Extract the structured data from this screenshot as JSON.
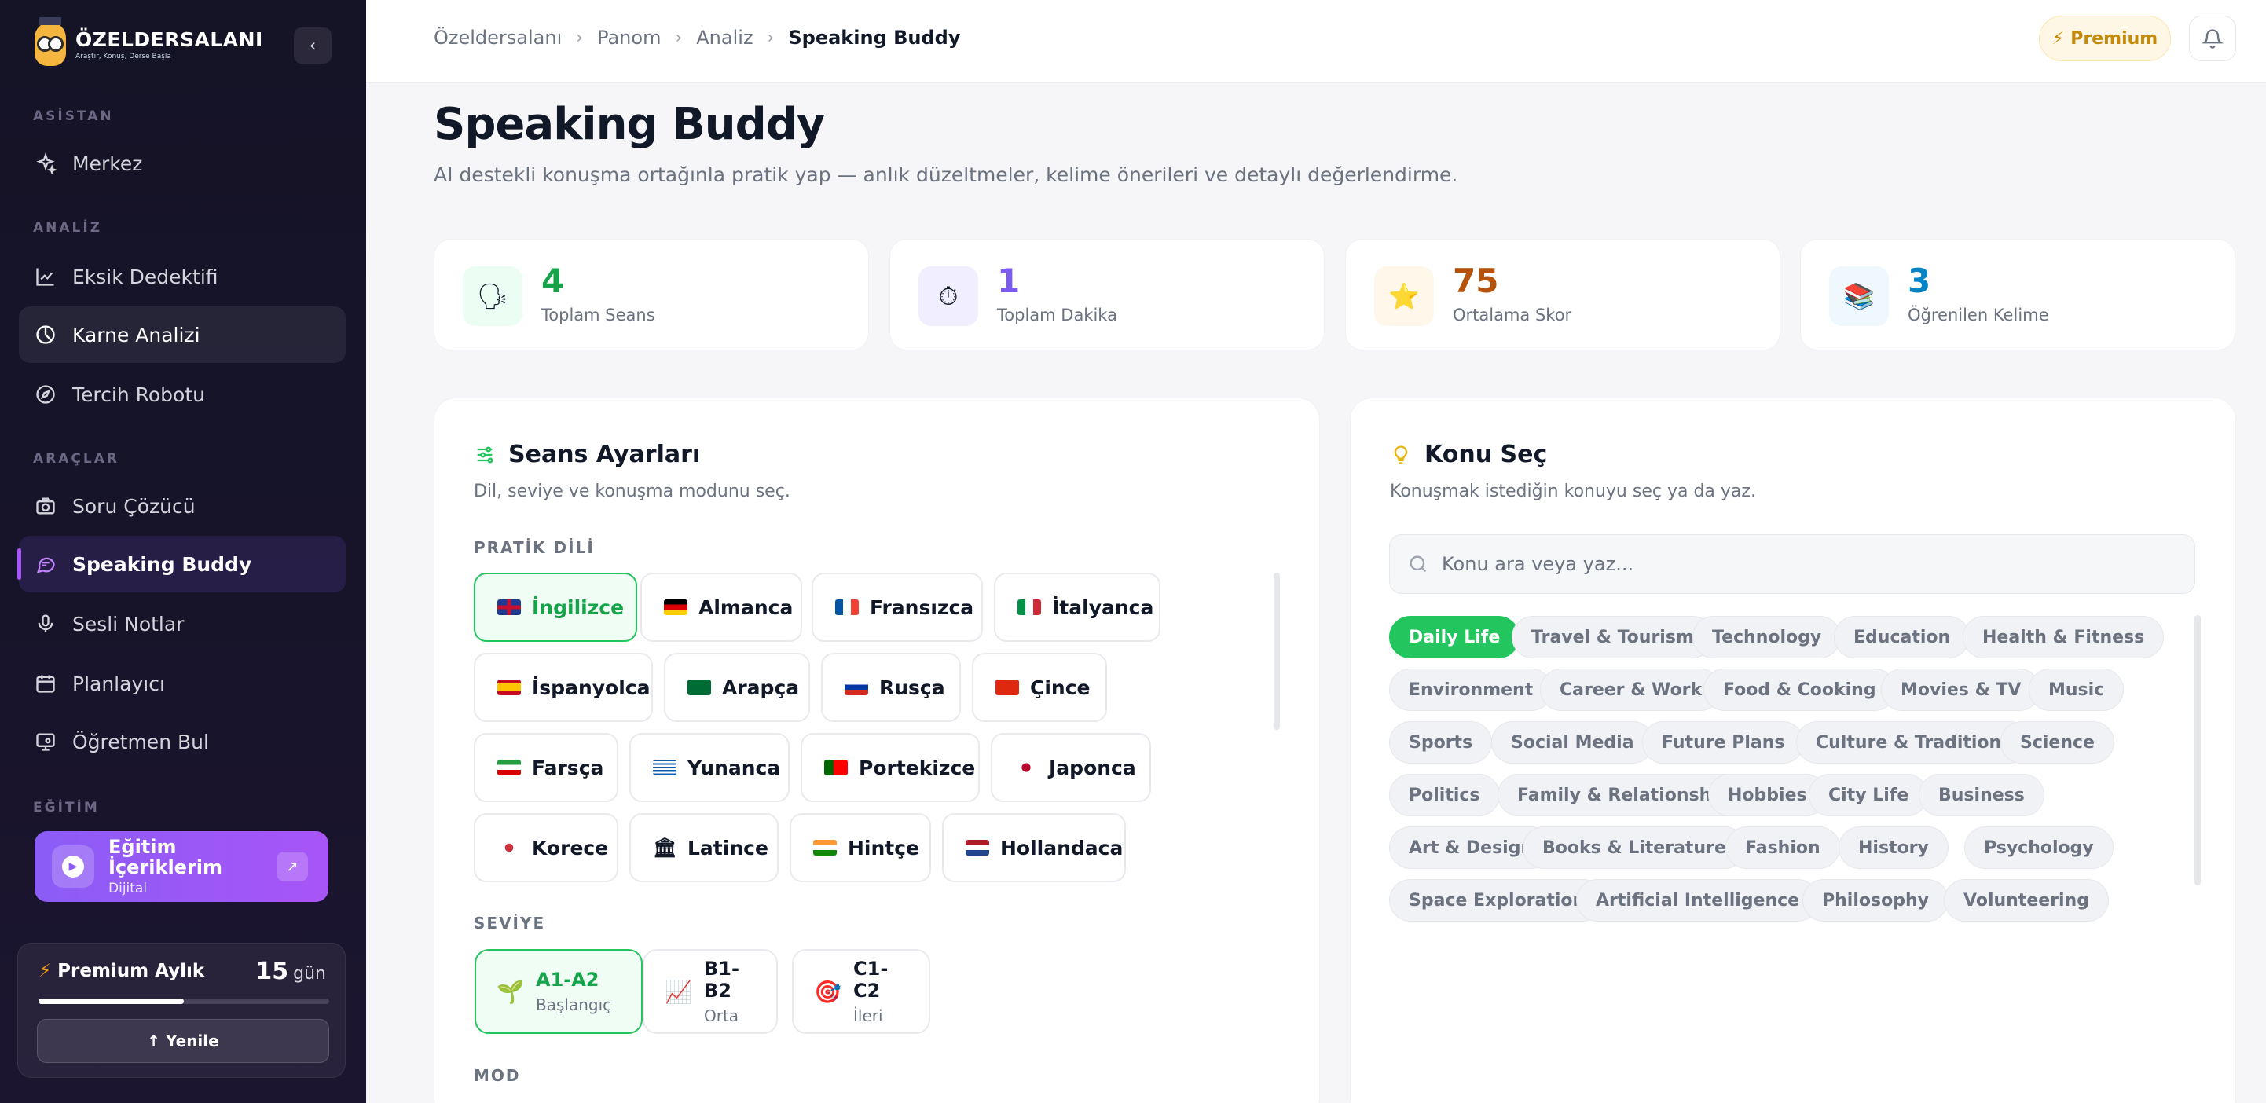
{
  "brand": {
    "name": "ÖZELDERSALANI",
    "tagline": "Araştır, Konuş, Derse Başla"
  },
  "sidebar": {
    "sections": [
      {
        "label": "ASİSTAN"
      },
      {
        "label": "ANALİZ"
      },
      {
        "label": "ARAÇLAR"
      },
      {
        "label": "EĞİTİM"
      }
    ],
    "items": [
      {
        "label": "Merkez",
        "icon": "sparkle-icon"
      },
      {
        "label": "Eksik Dedektifi",
        "icon": "chart-line-icon"
      },
      {
        "label": "Karne Analizi",
        "icon": "pie-chart-icon"
      },
      {
        "label": "Tercih Robotu",
        "icon": "compass-icon"
      },
      {
        "label": "Soru Çözücü",
        "icon": "camera-icon"
      },
      {
        "label": "Speaking Buddy",
        "icon": "chat-icon"
      },
      {
        "label": "Sesli Notlar",
        "icon": "microphone-icon"
      },
      {
        "label": "Planlayıcı",
        "icon": "calendar-icon"
      },
      {
        "label": "Öğretmen Bul",
        "icon": "monitor-user-icon"
      }
    ],
    "edu_card": {
      "title": "Eğitim İçeriklerim",
      "subtitle": "Dijital"
    },
    "premium": {
      "title": "Premium Aylık",
      "days": "15",
      "days_unit": "gün",
      "progress": 0.5,
      "renew_label": "↑ Yenile"
    }
  },
  "topbar": {
    "breadcrumb": [
      "Özeldersalanı",
      "Panom",
      "Analiz",
      "Speaking Buddy"
    ],
    "premium_label": "Premium"
  },
  "page": {
    "title": "Speaking Buddy",
    "subtitle": "AI destekli konuşma ortağınla pratik yap — anlık düzeltmeler, kelime önerileri ve detaylı değerlendirme."
  },
  "stats": [
    {
      "value": "4",
      "label": "Toplam Seans",
      "icon": "speaking-head-icon",
      "color": "#16a34a",
      "bg": "#ecfdf3"
    },
    {
      "value": "1",
      "label": "Toplam Dakika",
      "icon": "stopwatch-icon",
      "color": "#7c5cf0",
      "bg": "#f1efff"
    },
    {
      "value": "75",
      "label": "Ortalama Skor",
      "icon": "star-icon",
      "color": "#b45309",
      "bg": "#fff7ea"
    },
    {
      "value": "3",
      "label": "Öğrenilen Kelime",
      "icon": "books-icon",
      "color": "#0284c7",
      "bg": "#eef8fd"
    }
  ],
  "settings": {
    "title": "Seans Ayarları",
    "subtitle": "Dil, seviye ve konuşma modunu seç.",
    "language_label": "PRATİK DİLİ",
    "languages": [
      {
        "name": "İngilizce",
        "selected": true
      },
      {
        "name": "Almanca"
      },
      {
        "name": "Fransızca"
      },
      {
        "name": "İtalyanca"
      },
      {
        "name": "İspanyolca"
      },
      {
        "name": "Arapça"
      },
      {
        "name": "Rusça"
      },
      {
        "name": "Çince"
      },
      {
        "name": "Farsça"
      },
      {
        "name": "Yunanca"
      },
      {
        "name": "Portekizce"
      },
      {
        "name": "Japonca"
      },
      {
        "name": "Korece"
      },
      {
        "name": "Latince"
      },
      {
        "name": "Hintçe"
      },
      {
        "name": "Hollandaca"
      }
    ],
    "level_label": "SEVİYE",
    "levels": [
      {
        "name": "A1-A2",
        "desc": "Başlangıç",
        "icon": "seedling-icon",
        "selected": true
      },
      {
        "name": "B1-B2",
        "desc": "Orta",
        "icon": "chart-up-icon"
      },
      {
        "name": "C1-C2",
        "desc": "İleri",
        "icon": "target-icon"
      }
    ],
    "mode_label": "MOD"
  },
  "topics": {
    "title": "Konu Seç",
    "subtitle": "Konuşmak istediğin konuyu seç ya da yaz.",
    "search_placeholder": "Konu ara veya yaz...",
    "items": [
      "Daily Life",
      "Travel & Tourism",
      "Technology",
      "Education",
      "Health & Fitness",
      "Environment",
      "Career & Work",
      "Food & Cooking",
      "Movies & TV",
      "Music",
      "Sports",
      "Social Media",
      "Future Plans",
      "Culture & Traditions",
      "Science",
      "Politics",
      "Family & Relationships",
      "Hobbies",
      "City Life",
      "Business",
      "Art & Design",
      "Books & Literature",
      "Fashion",
      "History",
      "Psychology",
      "Space Exploration",
      "Artificial Intelligence",
      "Philosophy",
      "Volunteering"
    ],
    "selected": "Daily Life"
  }
}
